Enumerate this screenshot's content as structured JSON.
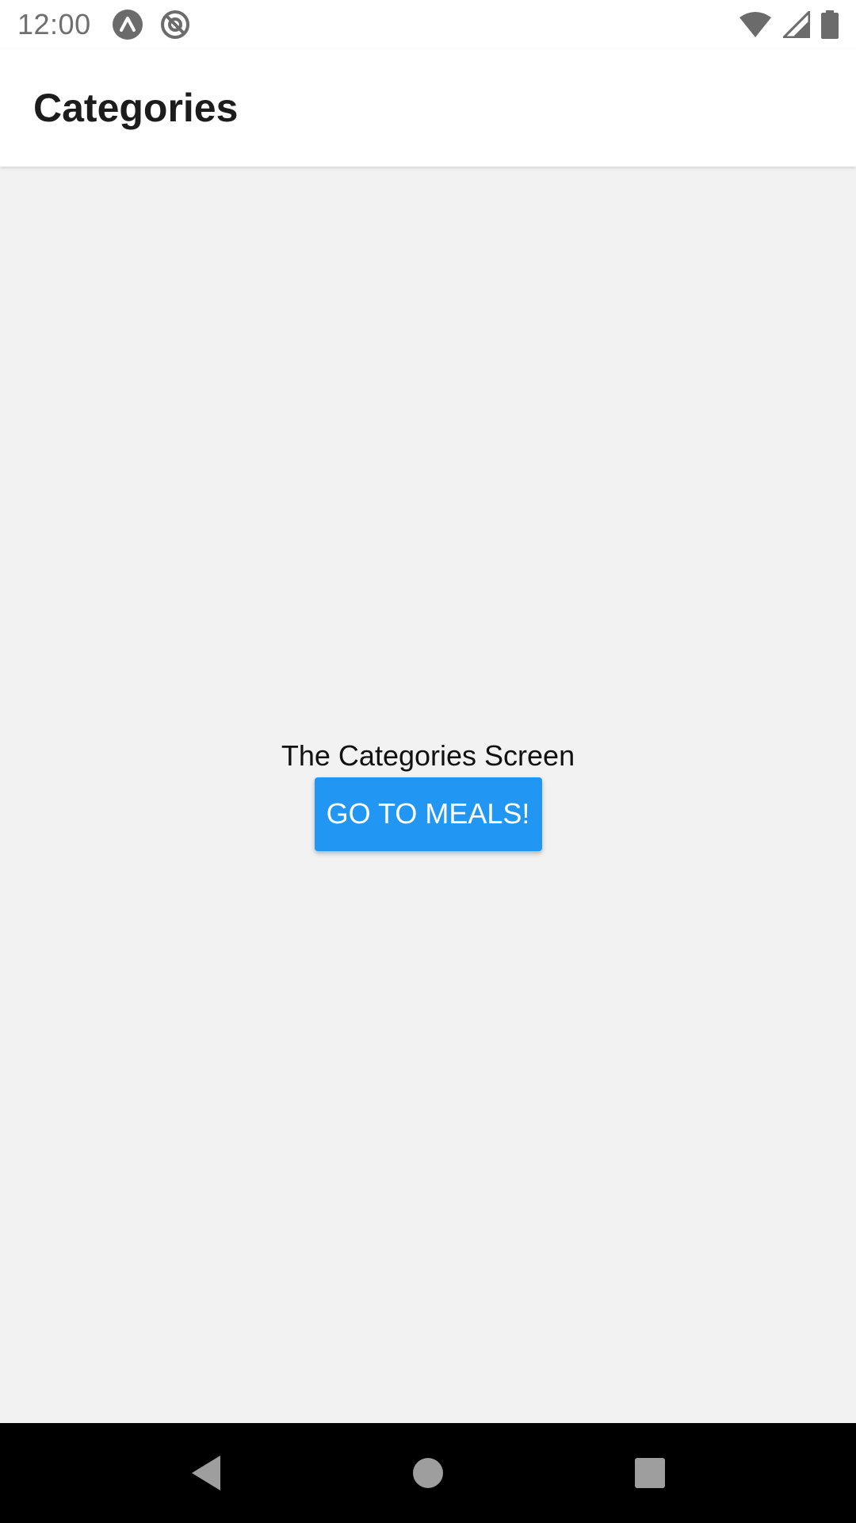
{
  "status_bar": {
    "time": "12:00",
    "left_icons": [
      "expo-icon",
      "no-sync-icon"
    ],
    "right_icons": [
      "wifi-icon",
      "signal-icon",
      "battery-icon"
    ]
  },
  "header": {
    "title": "Categories"
  },
  "main": {
    "screen_text": "The Categories Screen",
    "button_label": "GO TO MEALS!"
  },
  "nav_bar": {
    "buttons": [
      "back-icon",
      "home-icon",
      "recents-icon"
    ]
  },
  "colors": {
    "accent": "#2196f3",
    "background": "#f2f2f2",
    "header": "#ffffff",
    "nav": "#000000"
  }
}
